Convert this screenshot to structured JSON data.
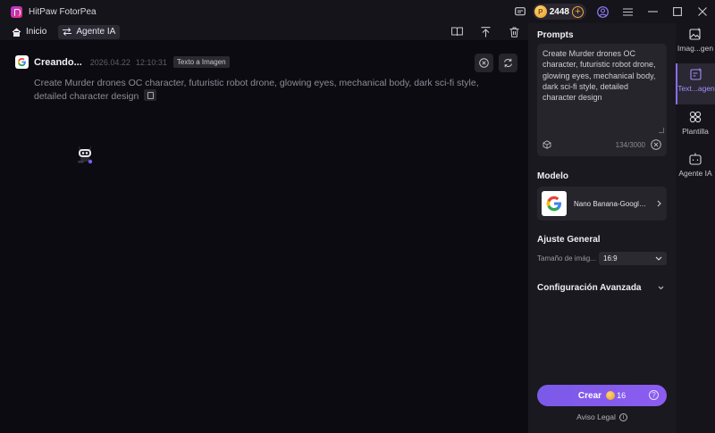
{
  "app": {
    "title": "HitPaw FotorPea",
    "coins": "2448",
    "coin_symbol": "P"
  },
  "toolbar": {
    "home_label": "Inicio",
    "agent_label": "Agente IA"
  },
  "task": {
    "title": "Creando...",
    "date": "2026.04.22",
    "time": "12:10:31",
    "tag": "Texto a Imagen",
    "prompt": "Create Murder drones OC character, futuristic robot drone, glowing eyes, mechanical body, dark sci-fi style, detailed character design"
  },
  "panel": {
    "prompts_label": "Prompts",
    "prompt_text": "Create Murder drones OC character, futuristic robot drone, glowing eyes, mechanical body, dark sci-fi style, detailed character design",
    "char_count": "134/3000",
    "model_label": "Modelo",
    "model_name": "Nano Banana-Google:...",
    "settings_label": "Ajuste General",
    "size_label": "Tamaño de imág...",
    "size_value": "16:9",
    "advanced_label": "Configuración Avanzada",
    "create_label": "Crear",
    "create_cost": "16",
    "legal_label": "Aviso Legal"
  },
  "rail": [
    {
      "label": "Imag...gen",
      "icon": "image-icon"
    },
    {
      "label": "Text...agen",
      "icon": "text-to-image-icon"
    },
    {
      "label": "Plantilla",
      "icon": "template-icon"
    },
    {
      "label": "Agente IA",
      "icon": "ai-agent-icon"
    }
  ],
  "colors": {
    "accent": "#8b6cf2",
    "background": "#0d0b12",
    "panel": "#1a1920"
  }
}
